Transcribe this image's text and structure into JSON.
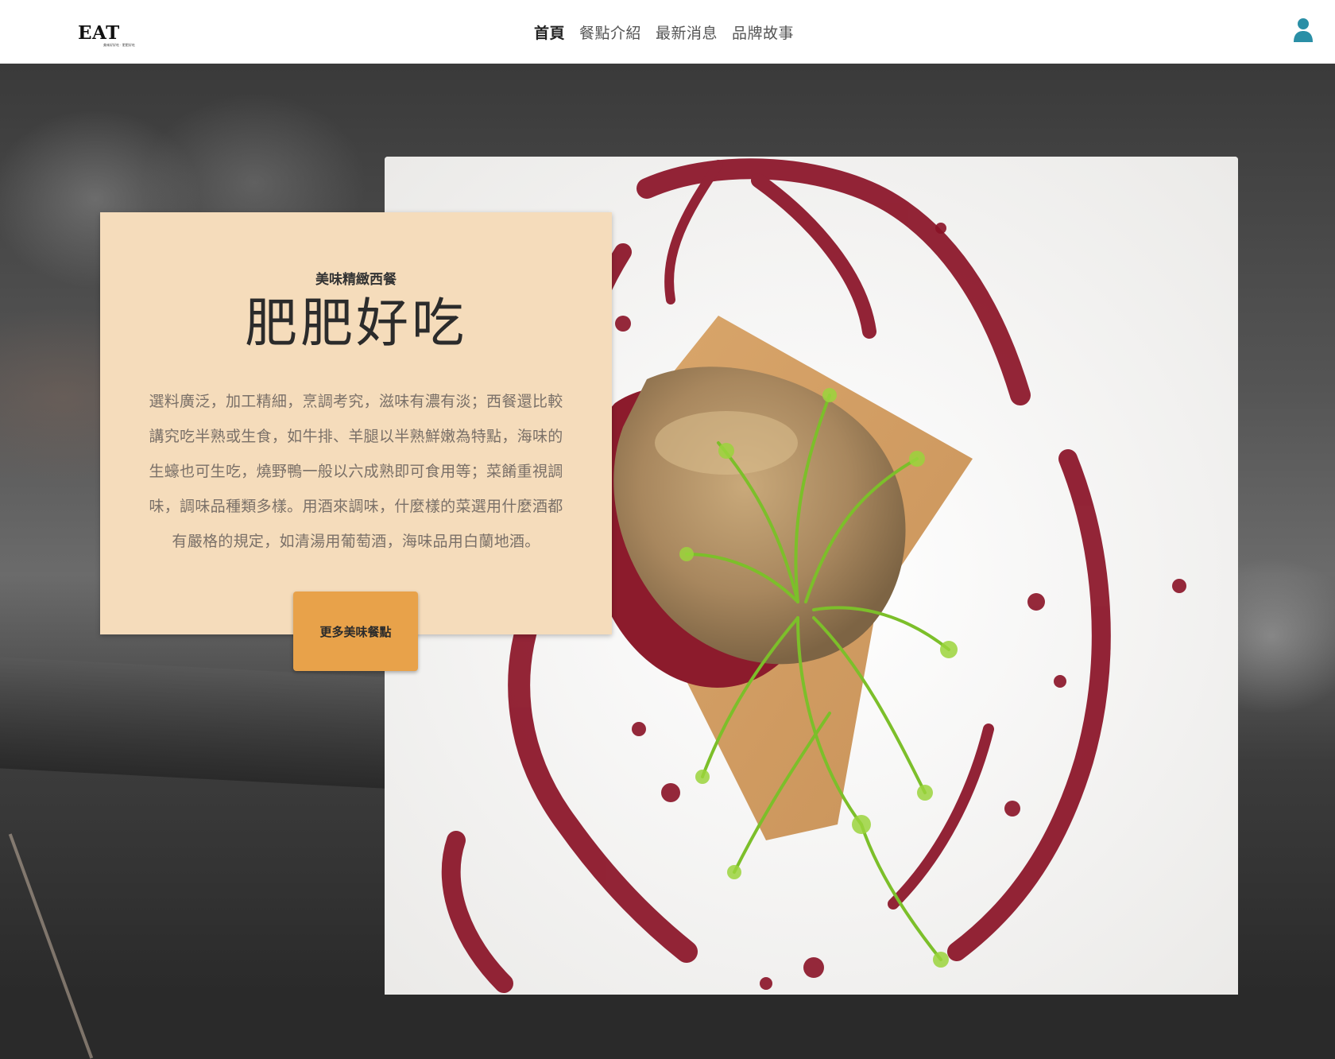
{
  "header": {
    "logo_text": "EAT",
    "logo_subtext": "美味好好吃 · 肥肥好吃",
    "nav": [
      {
        "label": "首頁",
        "active": true
      },
      {
        "label": "餐點介紹",
        "active": false
      },
      {
        "label": "最新消息",
        "active": false
      },
      {
        "label": "品牌故事",
        "active": false
      }
    ],
    "user_icon": "user-icon",
    "accent_color": "#2a8fa6"
  },
  "hero": {
    "subtitle": "美味精緻西餐",
    "title": "肥肥好吃",
    "description": "選料廣泛，加工精細，烹調考究，滋味有濃有淡；西餐還比較講究吃半熟或生食，如牛排、羊腿以半熟鮮嫩為特點，海味的生蠔也可生吃，燒野鴨一般以六成熟即可食用等；菜餚重視調味，調味品種類多樣。用酒來調味，什麼樣的菜選用什麼酒都有嚴格的規定，如清湯用葡萄酒，海味品用白蘭地酒。",
    "button_label": "更多美味餐點",
    "card_color": "#f5dcbb",
    "button_color": "#e8a24a"
  }
}
